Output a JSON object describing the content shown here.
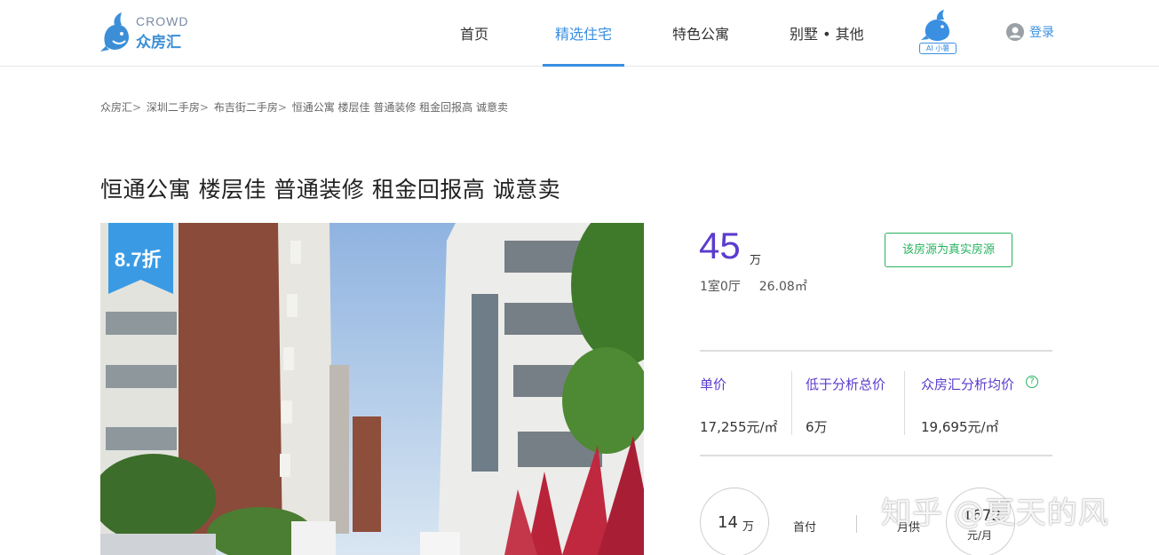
{
  "header": {
    "logo_en": "CROWD",
    "logo_cn": "众房汇",
    "nav": [
      {
        "label": "首页",
        "active": false
      },
      {
        "label": "精选住宅",
        "active": true
      },
      {
        "label": "特色公寓",
        "active": false
      },
      {
        "label": "别墅 • 其他",
        "active": false
      }
    ],
    "ai_label": "AI 小薯",
    "login_label": "登录",
    "accent_color": "#3a8fe0"
  },
  "breadcrumb": [
    {
      "label": "众房汇"
    },
    {
      "label": "深圳二手房"
    },
    {
      "label": "布吉街二手房"
    },
    {
      "label": "恒通公寓 楼层佳  普通装修 租金回报高  诚意卖"
    }
  ],
  "breadcrumb_sep": ">",
  "listing": {
    "title": "恒通公寓 楼层佳  普通装修 租金回报高  诚意卖",
    "discount_label": "8.7折",
    "price": "45",
    "price_unit": "万",
    "layout": "1室0厅",
    "area": "26.08㎡",
    "verified_label": "该房源为真实房源",
    "price_color": "#5b3ccd",
    "verified_color": "#27b35f"
  },
  "stats": [
    {
      "label": "单价",
      "value": "17,255元/㎡"
    },
    {
      "label": "低于分析总价",
      "value": "6万"
    },
    {
      "label": "众房汇分析均价",
      "value": "19,695元/㎡"
    }
  ],
  "payment": {
    "down_value": "14",
    "down_unit": "万",
    "down_label": "首付",
    "monthly_label": "月供",
    "monthly_value": "1672",
    "monthly_unit": "元/月"
  },
  "watermark": "知乎 @夏天的风"
}
